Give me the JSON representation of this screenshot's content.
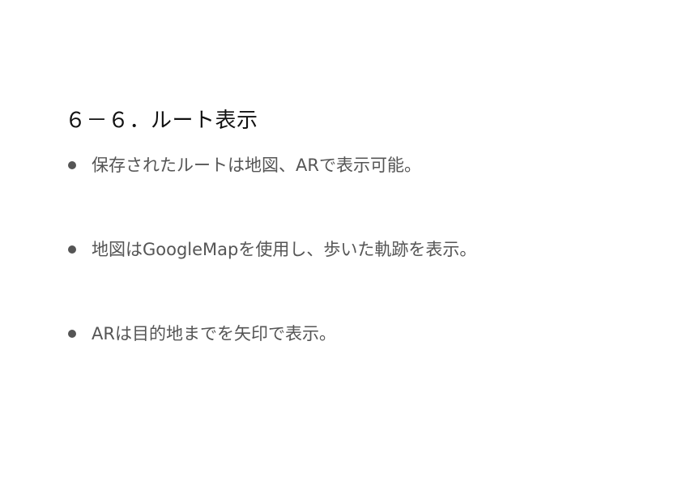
{
  "slide": {
    "title": "６－６．ルート表示",
    "bullets": [
      {
        "text": "保存されたルートは地図、ARで表示可能。"
      },
      {
        "text": "地図はGoogleMapを使用し、歩いた軌跡を表示。"
      },
      {
        "text": "ARは目的地までを矢印で表示。"
      }
    ]
  },
  "colors": {
    "title": "#111111",
    "body_text": "#555555",
    "bullet": "#555555",
    "background": "#ffffff"
  }
}
